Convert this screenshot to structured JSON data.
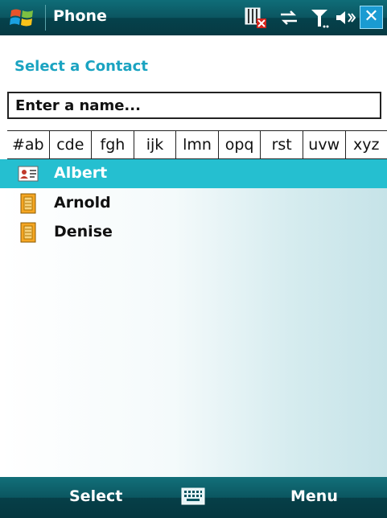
{
  "titlebar": {
    "app_title": "Phone",
    "status_icons": [
      "sim-error-icon",
      "data-connection-icon",
      "signal-strength-icon",
      "speaker-volume-icon"
    ],
    "close_label": "✕"
  },
  "header": {
    "title": "Select a Contact"
  },
  "search": {
    "placeholder": "Enter a name..."
  },
  "letter_tabs": [
    "#ab",
    "cde",
    "fgh",
    "ijk",
    "lmn",
    "opq",
    "rst",
    "uvw",
    "xyz"
  ],
  "contacts": [
    {
      "name": "Albert",
      "selected": true,
      "icon": "contact-card-icon"
    },
    {
      "name": "Arnold",
      "selected": false,
      "icon": "sim-contact-icon"
    },
    {
      "name": "Denise",
      "selected": false,
      "icon": "sim-contact-icon"
    }
  ],
  "softkeys": {
    "left": "Select",
    "right": "Menu",
    "center_icon": "keyboard-icon"
  },
  "colors": {
    "accent": "#1aa3c1",
    "selection": "#25bfd0",
    "bar": "#0b5560"
  }
}
